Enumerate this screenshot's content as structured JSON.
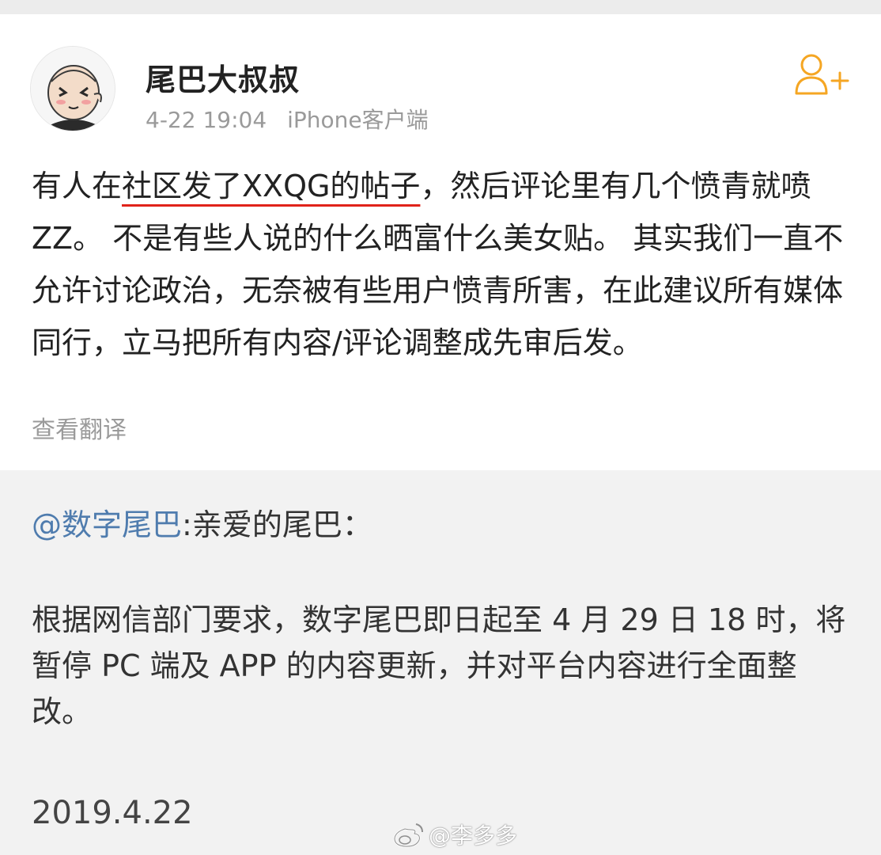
{
  "post": {
    "author": "尾巴大叔叔",
    "time": "4-22 19:04",
    "source": "iPhone客户端",
    "body": {
      "part1": "有人在",
      "underlined": "社区发了XXQG的帖子",
      "part2": "，然后评论里有几个愤青就喷ZZ。 不是有些人说的什么晒富什么美女贴。 其实我们一直不允许讨论政治，无奈被有些用户愤青所害，在此建议所有媒体同行，立马把所有内容/评论调整成先审后发。"
    },
    "translate_label": "查看翻译",
    "follow_icon": "add-user-icon",
    "accent_color": "#f5a623"
  },
  "repost": {
    "mention": "@数字尾巴",
    "greeting": ":亲爱的尾巴：",
    "body": "根据网信部门要求，数字尾巴即日起至 4 月 29 日 18 时，将暂停 PC 端及 APP 的内容更新，并对平台内容进行全面整改。",
    "date": "2019.4.22",
    "mention_color": "#4f7cae"
  },
  "watermark": {
    "text": "@李多多",
    "icon": "weibo-logo-icon"
  }
}
